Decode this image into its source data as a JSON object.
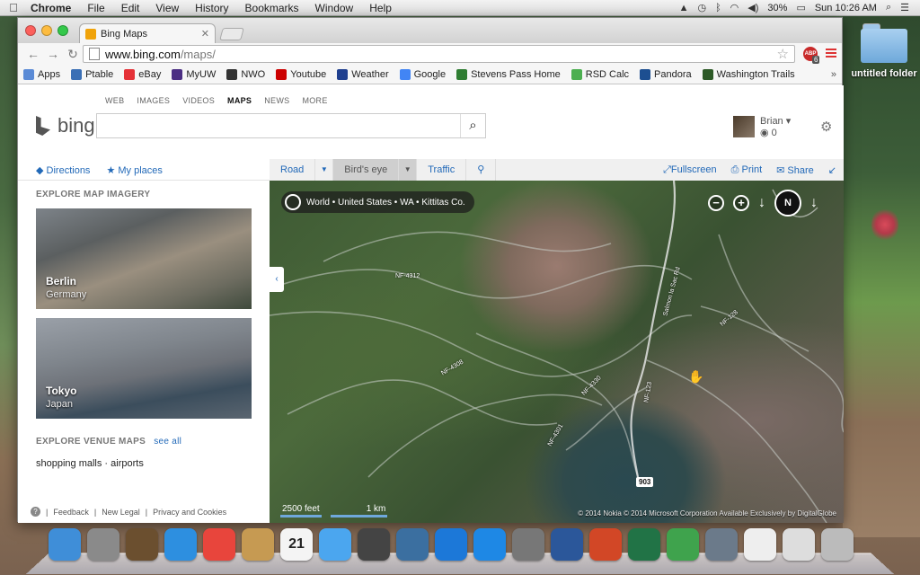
{
  "menubar": {
    "app": "Chrome",
    "items": [
      "File",
      "Edit",
      "View",
      "History",
      "Bookmarks",
      "Window",
      "Help"
    ],
    "battery": "30%",
    "clock": "Sun 10:26 AM"
  },
  "desktop": {
    "folder_label": "untitled folder"
  },
  "browser": {
    "tab_title": "Bing Maps",
    "url_host": "www.bing.com",
    "url_path": "/maps/",
    "abp_count": "6",
    "bookmarks": [
      {
        "label": "Apps",
        "color": "#5b8bd6"
      },
      {
        "label": "Ptable",
        "color": "#3a6fb5"
      },
      {
        "label": "eBay",
        "color": "#e53238"
      },
      {
        "label": "MyUW",
        "color": "#4b2e83"
      },
      {
        "label": "NWO",
        "color": "#333333"
      },
      {
        "label": "Youtube",
        "color": "#cc0000"
      },
      {
        "label": "Weather",
        "color": "#1f3f8f"
      },
      {
        "label": "Google",
        "color": "#4285f4"
      },
      {
        "label": "Stevens Pass Home",
        "color": "#2e7d32"
      },
      {
        "label": "RSD Calc",
        "color": "#4caf50"
      },
      {
        "label": "Pandora",
        "color": "#1d4f91"
      },
      {
        "label": "Washington Trails",
        "color": "#2d5a27"
      }
    ]
  },
  "bing": {
    "scopes": [
      "WEB",
      "IMAGES",
      "VIDEOS",
      "MAPS",
      "NEWS",
      "MORE"
    ],
    "active_scope": "MAPS",
    "logo_text": "bing",
    "user_name": "Brian",
    "rewards": "0",
    "directions": "Directions",
    "my_places": "My places",
    "modes": {
      "road": "Road",
      "birdseye": "Bird's eye",
      "traffic": "Traffic"
    },
    "actions": {
      "fullscreen": "Fullscreen",
      "print": "Print",
      "share": "Share"
    }
  },
  "sidebar": {
    "explore_title": "EXPLORE MAP IMAGERY",
    "cards": [
      {
        "city": "Berlin",
        "country": "Germany"
      },
      {
        "city": "Tokyo",
        "country": "Japan"
      }
    ],
    "venue_title": "EXPLORE VENUE MAPS",
    "see_all": "see all",
    "venue_links": "shopping malls · airports",
    "footer": [
      "Feedback",
      "New Legal",
      "Privacy and Cookies"
    ]
  },
  "map": {
    "breadcrumb": "World • United States • WA • Kittitas Co.",
    "compass": "N",
    "scale_feet": "2500 feet",
    "scale_km": "1 km",
    "copyright": "© 2014 Nokia   © 2014 Microsoft Corporation   Available Exclusively by DigitalGlobe",
    "highway": "903",
    "road_labels": [
      "NF-4312",
      "NF-4308",
      "NF-4330",
      "NF-4301",
      "NF-123",
      "NF-128",
      "Salmon la Sac Rd"
    ]
  },
  "dock": {
    "apps": [
      {
        "name": "Finder",
        "color": "#3f8ed8"
      },
      {
        "name": "Launchpad",
        "color": "#8a8a8a"
      },
      {
        "name": "Image Capture",
        "color": "#6b4f2f"
      },
      {
        "name": "Safari",
        "color": "#2d8fe0"
      },
      {
        "name": "Chrome",
        "color": "#e8453c"
      },
      {
        "name": "Contacts",
        "color": "#c69a52"
      },
      {
        "name": "Calendar",
        "color": "#f4f4f4"
      },
      {
        "name": "Messages",
        "color": "#4ba6ef"
      },
      {
        "name": "FaceTime",
        "color": "#444444"
      },
      {
        "name": "iPhoto",
        "color": "#3b6fa0"
      },
      {
        "name": "iTunes",
        "color": "#1c78d8"
      },
      {
        "name": "App Store",
        "color": "#1e88e5"
      },
      {
        "name": "System Preferences",
        "color": "#777777"
      },
      {
        "name": "Word",
        "color": "#2b579a"
      },
      {
        "name": "PowerPoint",
        "color": "#d24726"
      },
      {
        "name": "Excel",
        "color": "#217346"
      },
      {
        "name": "Downloader",
        "color": "#3fa34d"
      },
      {
        "name": "Network",
        "color": "#6b7a8a"
      },
      {
        "name": "Document",
        "color": "#eeeeee"
      },
      {
        "name": "Preview",
        "color": "#dddddd"
      },
      {
        "name": "Trash",
        "color": "#bbbbbb"
      }
    ],
    "calendar_day": "21"
  }
}
